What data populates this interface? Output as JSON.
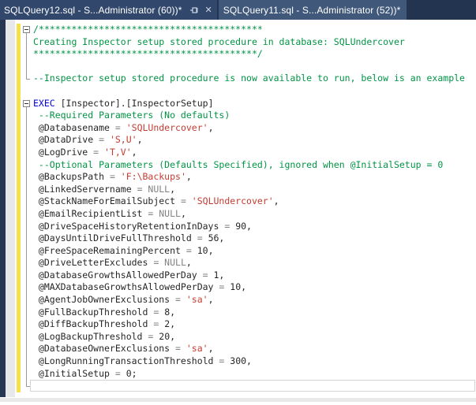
{
  "tabs": [
    {
      "label": "SQLQuery12.sql - S...Administrator (60))*",
      "active": true
    },
    {
      "label": "SQLQuery11.sql - S...Administrator (52))*",
      "active": false
    }
  ],
  "icons": {
    "pin": "pin-icon",
    "close_glyph": "✕"
  },
  "colors": {
    "tabbar_bg": "#22344f",
    "tab_active_bg": "#31486c",
    "tab_inactive_bg": "#40587a",
    "tab_text": "#ffffff",
    "editor_bg": "#ffffff",
    "margin_band": "#253752",
    "gutter": "#e7e8ea",
    "change_bar": "#f5e14b",
    "comment": "#029445",
    "keyword": "#0000e0",
    "string": "#c43c32",
    "operator": "#828282",
    "text": "#262626",
    "fold_line": "#9a9a9a",
    "current_line_border": "#d4d4d4",
    "scrollband": "#e9e9e9"
  },
  "code": {
    "lines": [
      {
        "fold": "start",
        "tokens": [
          [
            "com",
            "/*****************************************"
          ]
        ]
      },
      {
        "fold": "line",
        "tokens": [
          [
            "com",
            "Creating Inspector setup stored procedure in database: SQLUndercover"
          ]
        ]
      },
      {
        "fold": "line",
        "tokens": [
          [
            "com",
            "*****************************************/"
          ]
        ]
      },
      {
        "fold": "line",
        "tokens": []
      },
      {
        "fold": "end",
        "tokens": [
          [
            "com",
            "--Inspector setup stored procedure is now available to run, below is an example"
          ]
        ]
      },
      {
        "fold": null,
        "tokens": []
      },
      {
        "fold": "start",
        "tokens": [
          [
            "kw",
            "EXEC"
          ],
          [
            "txt",
            " [Inspector].[InspectorSetup]"
          ]
        ]
      },
      {
        "fold": "line",
        "tokens": [
          [
            "com",
            " --Required Parameters (No defaults)"
          ]
        ]
      },
      {
        "fold": "line",
        "tokens": [
          [
            "txt",
            " @Databasename "
          ],
          [
            "op",
            "= "
          ],
          [
            "str",
            "'SQLUndercover'"
          ],
          [
            "txt",
            ","
          ]
        ]
      },
      {
        "fold": "line",
        "tokens": [
          [
            "txt",
            " @DataDrive "
          ],
          [
            "op",
            "= "
          ],
          [
            "str",
            "'S,U'"
          ],
          [
            "txt",
            ","
          ]
        ]
      },
      {
        "fold": "line",
        "tokens": [
          [
            "txt",
            " @LogDrive "
          ],
          [
            "op",
            "= "
          ],
          [
            "str",
            "'T,V'"
          ],
          [
            "txt",
            ","
          ]
        ]
      },
      {
        "fold": "line",
        "tokens": [
          [
            "com",
            " --Optional Parameters (Defaults Specified), ignored when @InitialSetup = 0"
          ]
        ]
      },
      {
        "fold": "line",
        "tokens": [
          [
            "txt",
            " @BackupsPath "
          ],
          [
            "op",
            "= "
          ],
          [
            "str",
            "'F:\\Backups'"
          ],
          [
            "txt",
            ","
          ]
        ]
      },
      {
        "fold": "line",
        "tokens": [
          [
            "txt",
            " @LinkedServername "
          ],
          [
            "op",
            "= NULL"
          ],
          [
            "txt",
            ","
          ]
        ]
      },
      {
        "fold": "line",
        "tokens": [
          [
            "txt",
            " @StackNameForEmailSubject "
          ],
          [
            "op",
            "= "
          ],
          [
            "str",
            "'SQLUndercover'"
          ],
          [
            "txt",
            ","
          ]
        ]
      },
      {
        "fold": "line",
        "tokens": [
          [
            "txt",
            " @EmailRecipientList "
          ],
          [
            "op",
            "= NULL"
          ],
          [
            "txt",
            ","
          ]
        ]
      },
      {
        "fold": "line",
        "tokens": [
          [
            "txt",
            " @DriveSpaceHistoryRetentionInDays "
          ],
          [
            "op",
            "= "
          ],
          [
            "txt",
            "90,"
          ]
        ]
      },
      {
        "fold": "line",
        "tokens": [
          [
            "txt",
            " @DaysUntilDriveFullThreshold "
          ],
          [
            "op",
            "= "
          ],
          [
            "txt",
            "56,"
          ]
        ]
      },
      {
        "fold": "line",
        "tokens": [
          [
            "txt",
            " @FreeSpaceRemainingPercent "
          ],
          [
            "op",
            "= "
          ],
          [
            "txt",
            "10,"
          ]
        ]
      },
      {
        "fold": "line",
        "tokens": [
          [
            "txt",
            " @DriveLetterExcludes "
          ],
          [
            "op",
            "= NULL"
          ],
          [
            "txt",
            ","
          ]
        ]
      },
      {
        "fold": "line",
        "tokens": [
          [
            "txt",
            " @DatabaseGrowthsAllowedPerDay "
          ],
          [
            "op",
            "= "
          ],
          [
            "txt",
            "1,"
          ]
        ]
      },
      {
        "fold": "line",
        "tokens": [
          [
            "txt",
            " @MAXDatabaseGrowthsAllowedPerDay "
          ],
          [
            "op",
            "= "
          ],
          [
            "txt",
            "10,"
          ]
        ]
      },
      {
        "fold": "line",
        "tokens": [
          [
            "txt",
            " @AgentJobOwnerExclusions "
          ],
          [
            "op",
            "= "
          ],
          [
            "str",
            "'sa'"
          ],
          [
            "txt",
            ","
          ]
        ]
      },
      {
        "fold": "line",
        "tokens": [
          [
            "txt",
            " @FullBackupThreshold "
          ],
          [
            "op",
            "= "
          ],
          [
            "txt",
            "8,"
          ]
        ]
      },
      {
        "fold": "line",
        "tokens": [
          [
            "txt",
            " @DiffBackupThreshold "
          ],
          [
            "op",
            "= "
          ],
          [
            "txt",
            "2,"
          ]
        ]
      },
      {
        "fold": "line",
        "tokens": [
          [
            "txt",
            " @LogBackupThreshold "
          ],
          [
            "op",
            "= "
          ],
          [
            "txt",
            "20,"
          ]
        ]
      },
      {
        "fold": "line",
        "tokens": [
          [
            "txt",
            " @DatabaseOwnerExclusions "
          ],
          [
            "op",
            "= "
          ],
          [
            "str",
            "'sa'"
          ],
          [
            "txt",
            ","
          ]
        ]
      },
      {
        "fold": "line",
        "tokens": [
          [
            "txt",
            " @LongRunningTransactionThreshold "
          ],
          [
            "op",
            "= "
          ],
          [
            "txt",
            "300,"
          ]
        ]
      },
      {
        "fold": "line",
        "tokens": [
          [
            "txt",
            " @InitialSetup "
          ],
          [
            "op",
            "= "
          ],
          [
            "txt",
            "0;"
          ]
        ]
      },
      {
        "fold": "end",
        "tokens": []
      }
    ]
  }
}
